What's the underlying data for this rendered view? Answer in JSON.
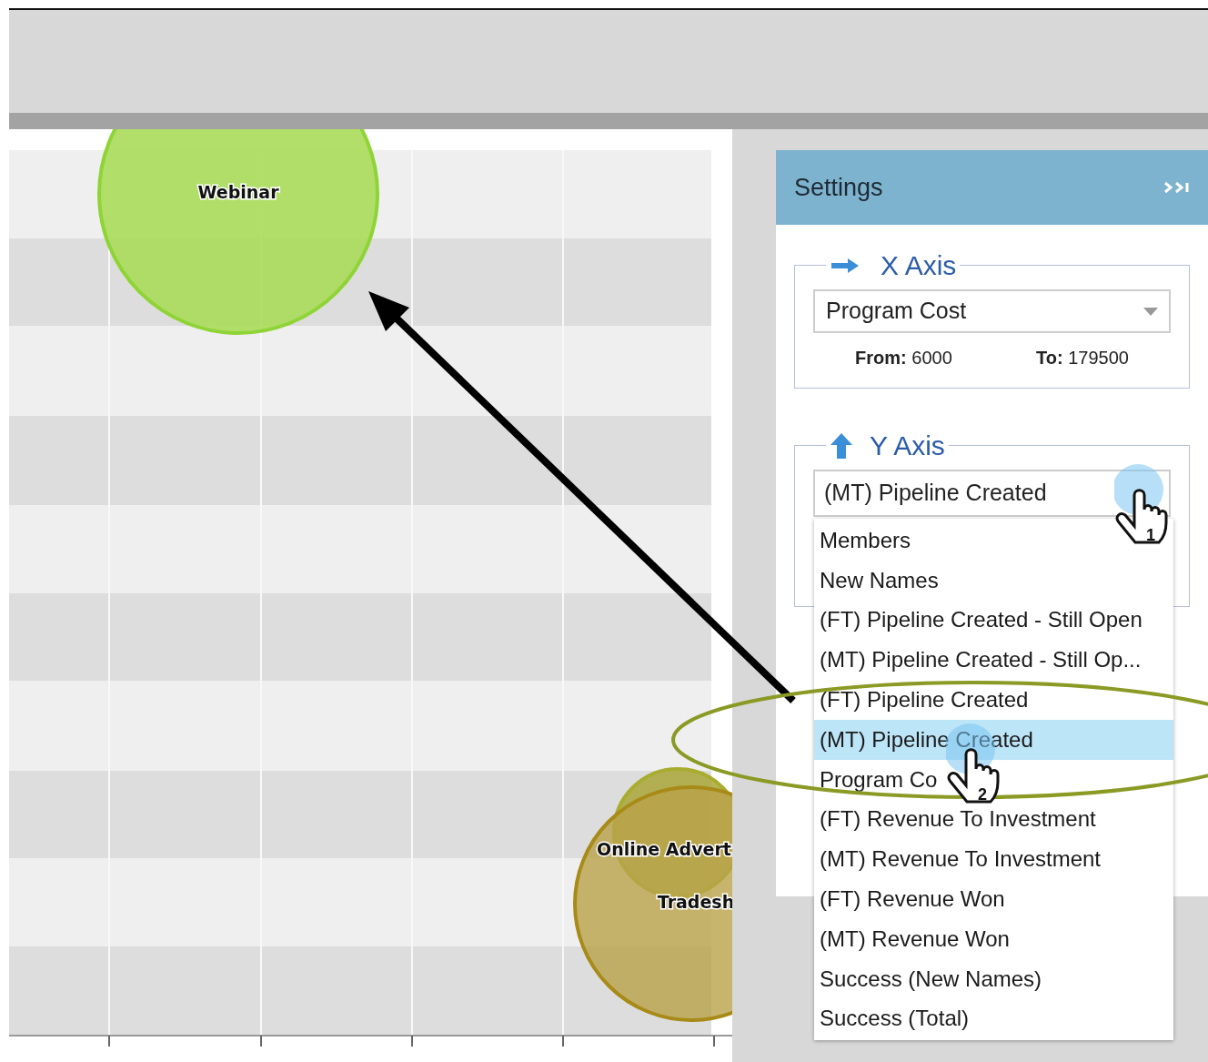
{
  "chart": {
    "bubbles": [
      {
        "label": "Webinar",
        "color": "#a8dc5a"
      },
      {
        "label": "Online Advert",
        "color": "#aaa73a"
      },
      {
        "label": "Tradesh",
        "color": "#b9a24a"
      }
    ]
  },
  "settings": {
    "title": "Settings",
    "x_axis": {
      "legend": "X Axis",
      "value": "Program Cost",
      "from_label": "From:",
      "from_value": "6000",
      "to_label": "To:",
      "to_value": "179500"
    },
    "y_axis": {
      "legend": "Y Axis",
      "value": "(MT) Pipeline Created",
      "options": [
        {
          "label": "Members",
          "selected": false
        },
        {
          "label": "New Names",
          "selected": false
        },
        {
          "label": "(FT) Pipeline Created - Still Open",
          "selected": false
        },
        {
          "label": "(MT) Pipeline Created - Still Op...",
          "selected": false
        },
        {
          "label": "(FT) Pipeline Created",
          "selected": false
        },
        {
          "label": "(MT) Pipeline Created",
          "selected": true
        },
        {
          "label": "Program Co",
          "selected": false
        },
        {
          "label": "(FT) Revenue To Investment",
          "selected": false
        },
        {
          "label": "(MT) Revenue To Investment",
          "selected": false
        },
        {
          "label": "(FT) Revenue Won",
          "selected": false
        },
        {
          "label": "(MT) Revenue Won",
          "selected": false
        },
        {
          "label": "Success (New Names)",
          "selected": false
        },
        {
          "label": "Success (Total)",
          "selected": false
        }
      ]
    }
  },
  "cursor_steps": [
    "1",
    "2"
  ]
}
